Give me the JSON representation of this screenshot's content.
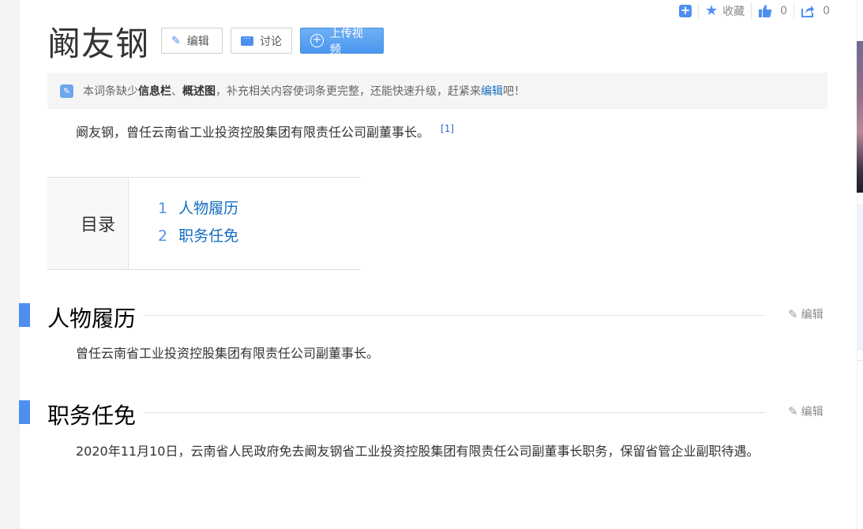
{
  "top_actions": {
    "favorite_label": "收藏",
    "like_count": "0",
    "share_count": "0"
  },
  "title": "阚友钢",
  "buttons": {
    "edit_label": "编辑",
    "discuss_label": "讨论",
    "upload_label": "上传视频"
  },
  "notice": {
    "text_1": "本词条缺少",
    "bold_1": "信息栏",
    "text_2": "、",
    "bold_2": "概述图",
    "text_3": "，补充相关内容使词条更完整，还能快速升级，赶紧来",
    "link": "编辑",
    "text_4": "吧！"
  },
  "summary": {
    "text": "阚友钢，曾任云南省工业投资控股集团有限责任公司副董事长。",
    "ref": "[1]"
  },
  "toc": {
    "heading": "目录",
    "items": [
      {
        "num": "1",
        "label": "人物履历"
      },
      {
        "num": "2",
        "label": "职务任免"
      }
    ]
  },
  "sections": [
    {
      "title": "人物履历",
      "edit_label": "编辑",
      "body": "曾任云南省工业投资控股集团有限责任公司副董事长。"
    },
    {
      "title": "职务任免",
      "edit_label": "编辑",
      "body": "2020年11月10日，云南省人民政府免去阚友钢省工业投资控股集团有限责任公司副董事长职务，保留省管企业副职待遇。"
    }
  ],
  "colors": {
    "accent": "#4d8ff0",
    "link": "#136ec2"
  }
}
